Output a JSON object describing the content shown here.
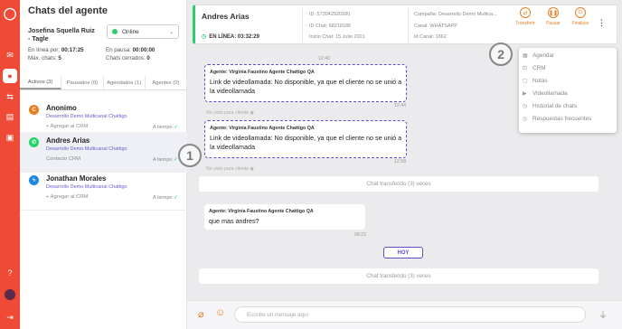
{
  "sidebar_title": "Chats del agente",
  "agent": {
    "name": "Josefina Squella Ruiz - Tagle",
    "status": "Online",
    "online_label": "En línea por:",
    "online_value": "00:17:25",
    "max_chats_label": "Máx. chats:",
    "max_chats_value": "5",
    "pause_label": "En pausa:",
    "pause_value": "00:00:00",
    "closed_label": "Chats cerrados:",
    "closed_value": "0"
  },
  "tabs": [
    "Activos (3)",
    "Pausados (0)",
    "Agendados (1)",
    "Agentes (0)"
  ],
  "chats": [
    {
      "name": "Anonimo",
      "company": "Desarrollo Demo Multicanal Chattigo",
      "crm": "+ Agregar al CRM",
      "time": "A tiempo",
      "channel_color": "#e67e22",
      "channel_icon": "webchat-icon"
    },
    {
      "name": "Andres Arias",
      "company": "Desarrollo Demo Multicanal Chattigo",
      "crm": "Contacto CRM",
      "time": "A tiempo",
      "channel_color": "#25d366",
      "channel_icon": "whatsapp-icon"
    },
    {
      "name": "Jonathan Morales",
      "company": "Desarrollo Demo Multicanal Chattigo",
      "crm": "+ Agregar al CRM",
      "time": "A tiempo",
      "channel_color": "#1e88e5",
      "channel_icon": "messenger-icon"
    }
  ],
  "chat_header": {
    "name": "Andres Arias",
    "online": "EN LÍNEA: 03:32:29",
    "id": "ID: 573042920180",
    "chat_id": "ID Chat: 68218186",
    "start": "Inicio Chat: 15 Julio 2021",
    "campaign": "Campaña: Desarrollo Demo Multica...",
    "channel": "Canal: WHATSAPP",
    "cal_id": "Id Canal: 1662"
  },
  "actions": [
    "Transferir",
    "Pausar",
    "Finalizar"
  ],
  "messages": {
    "ts1": "12:40",
    "m1_who": "Agente: Virginia Faustino Agente Chattigo QA",
    "m1_text": "Link de videollamada: No disponible, ya que el cliente no se unió a la videollamada",
    "m1_ts": "12:44",
    "note1": "No visto para cliente",
    "m2_who": "Agente: Virginia Faustino Agente Chattigo QA",
    "m2_text": "Link de videollamada: No disponible, ya que el cliente no se unió a la videollamada",
    "m2_ts": "12:58",
    "note2": "No visto para cliente",
    "sys1": "Chat transferido (3) veces",
    "m3_who": "Agente: Virginia Faustino Agente Chattigo QA",
    "m3_text": "que mas andres?",
    "m3_ts": "08:23",
    "today": "HOY",
    "sys2": "Chat transferido (3) veces"
  },
  "menu": [
    "Agendar",
    "CRM",
    "Notas",
    "Videollamada",
    "Historial de chats",
    "Respuestas frecuentes"
  ],
  "input_placeholder": "Escribe un mensaje aquí",
  "callouts": [
    "1",
    "2"
  ]
}
